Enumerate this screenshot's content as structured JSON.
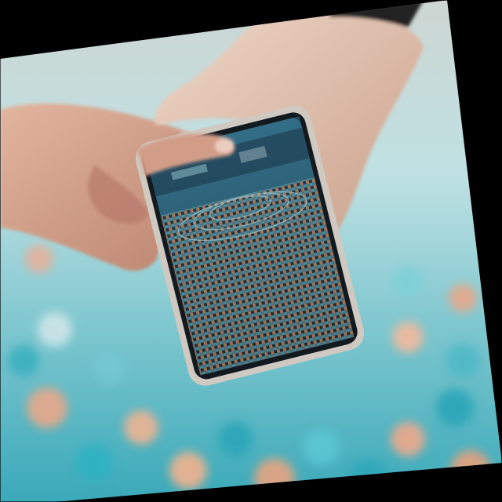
{
  "image": {
    "subject": "photo",
    "colors": {
      "background_bokeh_cyan": "#4fb9c6",
      "background_bokeh_peach": "#e9a889",
      "skin": "#d9a58c",
      "phone_frame": "#c9c3bb",
      "screen_dark": "#1a2a36",
      "border": "#000000"
    }
  }
}
